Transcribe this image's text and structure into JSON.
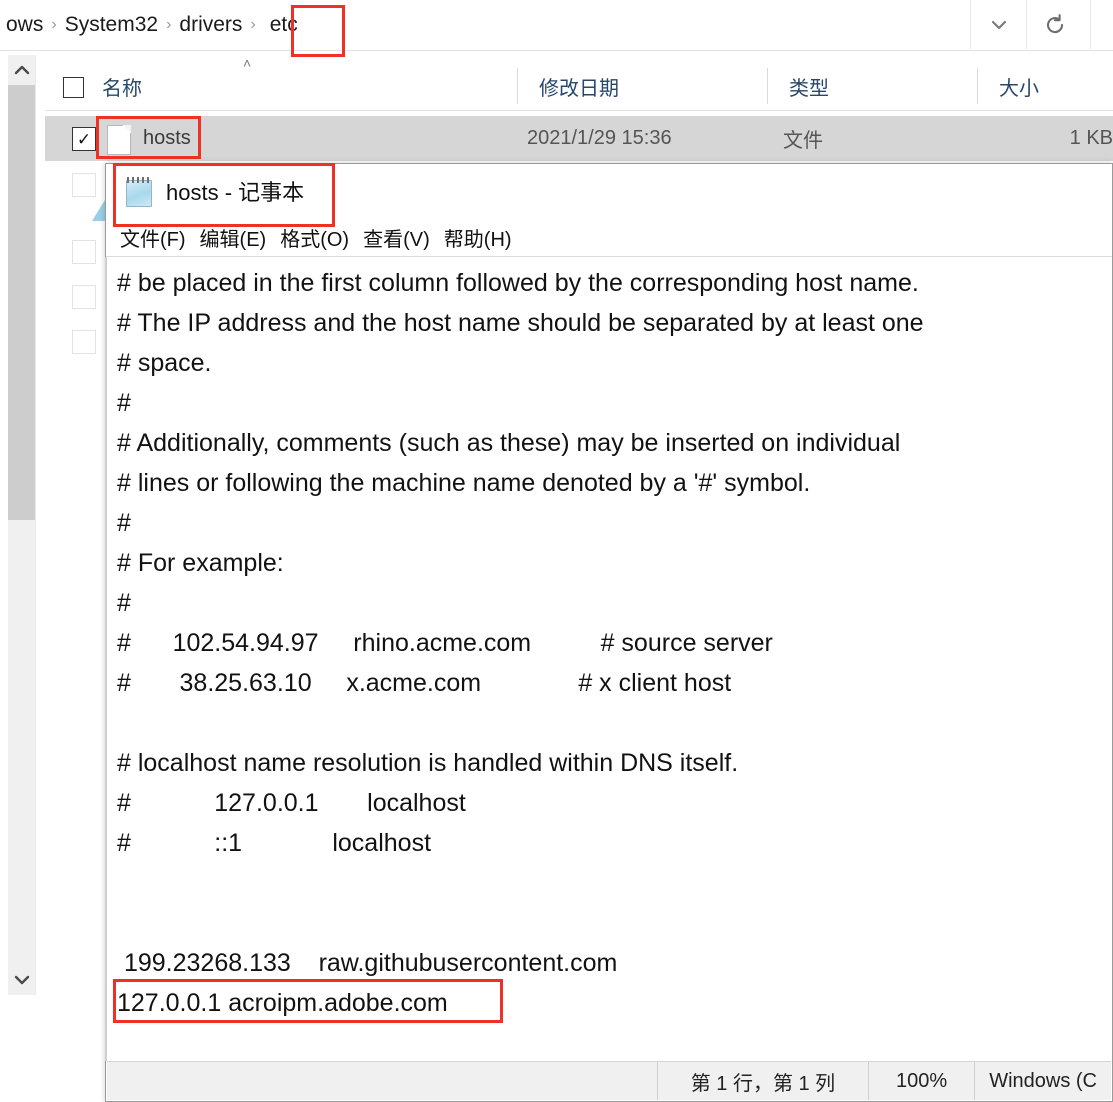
{
  "explorer": {
    "breadcrumb": {
      "items": [
        "ows",
        "System32",
        "drivers",
        "etc"
      ],
      "separator": "›"
    },
    "address_buttons": {
      "dropdown": "˅",
      "refresh": "↺"
    },
    "columns": [
      {
        "key": "name",
        "label": "名称"
      },
      {
        "key": "date",
        "label": "修改日期"
      },
      {
        "key": "type",
        "label": "类型"
      },
      {
        "key": "size",
        "label": "大小"
      }
    ],
    "sort_indicator": "˄",
    "rows": [
      {
        "name": "hosts",
        "date": "2021/1/29 15:36",
        "type": "文件",
        "size": "1 KB",
        "checked": true,
        "selected": true,
        "check_glyph": "✓"
      }
    ],
    "scrollbar": {
      "up": "⌃",
      "down": "⌄"
    }
  },
  "notepad": {
    "title": "hosts - 记事本",
    "menu": [
      "文件(F)",
      "编辑(E)",
      "格式(O)",
      "查看(V)",
      "帮助(H)"
    ],
    "lines": [
      "# be placed in the first column followed by the corresponding host name.",
      "# The IP address and the host name should be separated by at least one",
      "# space.",
      "#",
      "# Additionally, comments (such as these) may be inserted on individual",
      "# lines or following the machine name denoted by a '#' symbol.",
      "#",
      "# For example:",
      "#",
      "#      102.54.94.97     rhino.acme.com          # source server",
      "#       38.25.63.10     x.acme.com              # x client host",
      "",
      "# localhost name resolution is handled within DNS itself.",
      "#            127.0.0.1       localhost",
      "#            ::1             localhost",
      "",
      "",
      " 199.23268.133    raw.githubusercontent.com",
      "127.0.0.1 acroipm.adobe.com"
    ],
    "status": {
      "position": "第 1 行，第 1 列",
      "zoom": "100%",
      "line_ending": "Windows (C"
    }
  },
  "annotations": {
    "accent_color": "#ee3124",
    "boxes": [
      {
        "name": "etc-breadcrumb-highlight"
      },
      {
        "name": "hosts-file-highlight"
      },
      {
        "name": "notepad-title-highlight"
      },
      {
        "name": "acroipm-entry-highlight"
      }
    ]
  }
}
